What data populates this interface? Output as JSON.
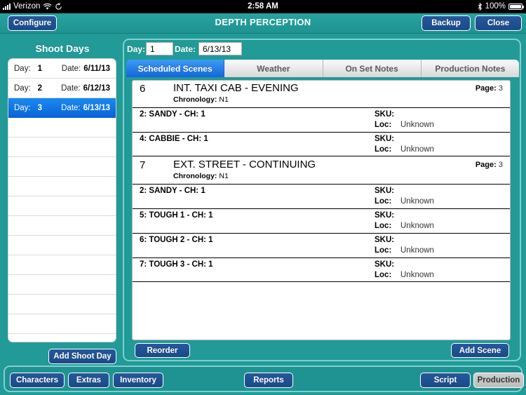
{
  "statusbar": {
    "carrier": "Verizon",
    "signal_icon": "signal-bars-icon",
    "wifi_icon": "wifi-icon",
    "sync_icon": "sync-icon",
    "time": "2:58 AM",
    "bluetooth_icon": "bluetooth-icon",
    "battery_percent": "100%",
    "battery_icon": "battery-full-icon"
  },
  "titlebar": {
    "configure_label": "Configure",
    "app_title": "DEPTH PERCEPTION",
    "backup_label": "Backup",
    "close_label": "Close"
  },
  "sidebar": {
    "title": "Shoot Days",
    "day_label": "Day:",
    "date_label": "Date:",
    "rows": [
      {
        "day": "1",
        "date": "6/11/13",
        "selected": false
      },
      {
        "day": "2",
        "date": "6/12/13",
        "selected": false
      },
      {
        "day": "3",
        "date": "6/13/13",
        "selected": true
      }
    ],
    "empty_row_count": 11,
    "add_shoot_day_label": "Add Shoot Day"
  },
  "fields": {
    "day_label": "Day:",
    "day_value": "1",
    "date_label": "Date:",
    "date_value": "6/13/13"
  },
  "tabs": [
    {
      "label": "Scheduled Scenes",
      "active": true
    },
    {
      "label": "Weather",
      "active": false
    },
    {
      "label": "On Set Notes",
      "active": false
    },
    {
      "label": "Production Notes",
      "active": false
    }
  ],
  "scene_labels": {
    "page_label": "Page:",
    "chronology_label": "Chronology:",
    "sku_label": "SKU:",
    "loc_label": "Loc:"
  },
  "scenes": [
    {
      "number": "6",
      "title": "INT. TAXI CAB - EVENING",
      "page": "3",
      "chronology": "N1",
      "characters": [
        {
          "name": "2: SANDY - CH: 1",
          "sku": "",
          "loc": "Unknown"
        },
        {
          "name": "4: CABBIE - CH: 1",
          "sku": "",
          "loc": "Unknown"
        }
      ]
    },
    {
      "number": "7",
      "title": "EXT. STREET - CONTINUING",
      "page": "3",
      "chronology": "N1",
      "characters": [
        {
          "name": "2: SANDY - CH: 1",
          "sku": "",
          "loc": "Unknown"
        },
        {
          "name": "5: TOUGH 1 - CH: 1",
          "sku": "",
          "loc": "Unknown"
        },
        {
          "name": "6: TOUGH 2 - CH: 1",
          "sku": "",
          "loc": "Unknown"
        },
        {
          "name": "7: TOUGH 3 - CH: 1",
          "sku": "",
          "loc": "Unknown"
        }
      ]
    }
  ],
  "panel_actions": {
    "reorder_label": "Reorder",
    "add_scene_label": "Add Scene"
  },
  "bottom_bar": {
    "characters_label": "Characters",
    "extras_label": "Extras",
    "inventory_label": "Inventory",
    "reports_label": "Reports",
    "script_label": "Script",
    "production_label": "Production"
  },
  "colors": {
    "teal_bg": "#219a98",
    "teal_border": "#7fd0ce",
    "button_blue": "#1d4f91",
    "selected_row_blue": "#0a63d6",
    "active_tab_blue": "#1266d8",
    "disabled_gray": "#c6c6c6"
  }
}
